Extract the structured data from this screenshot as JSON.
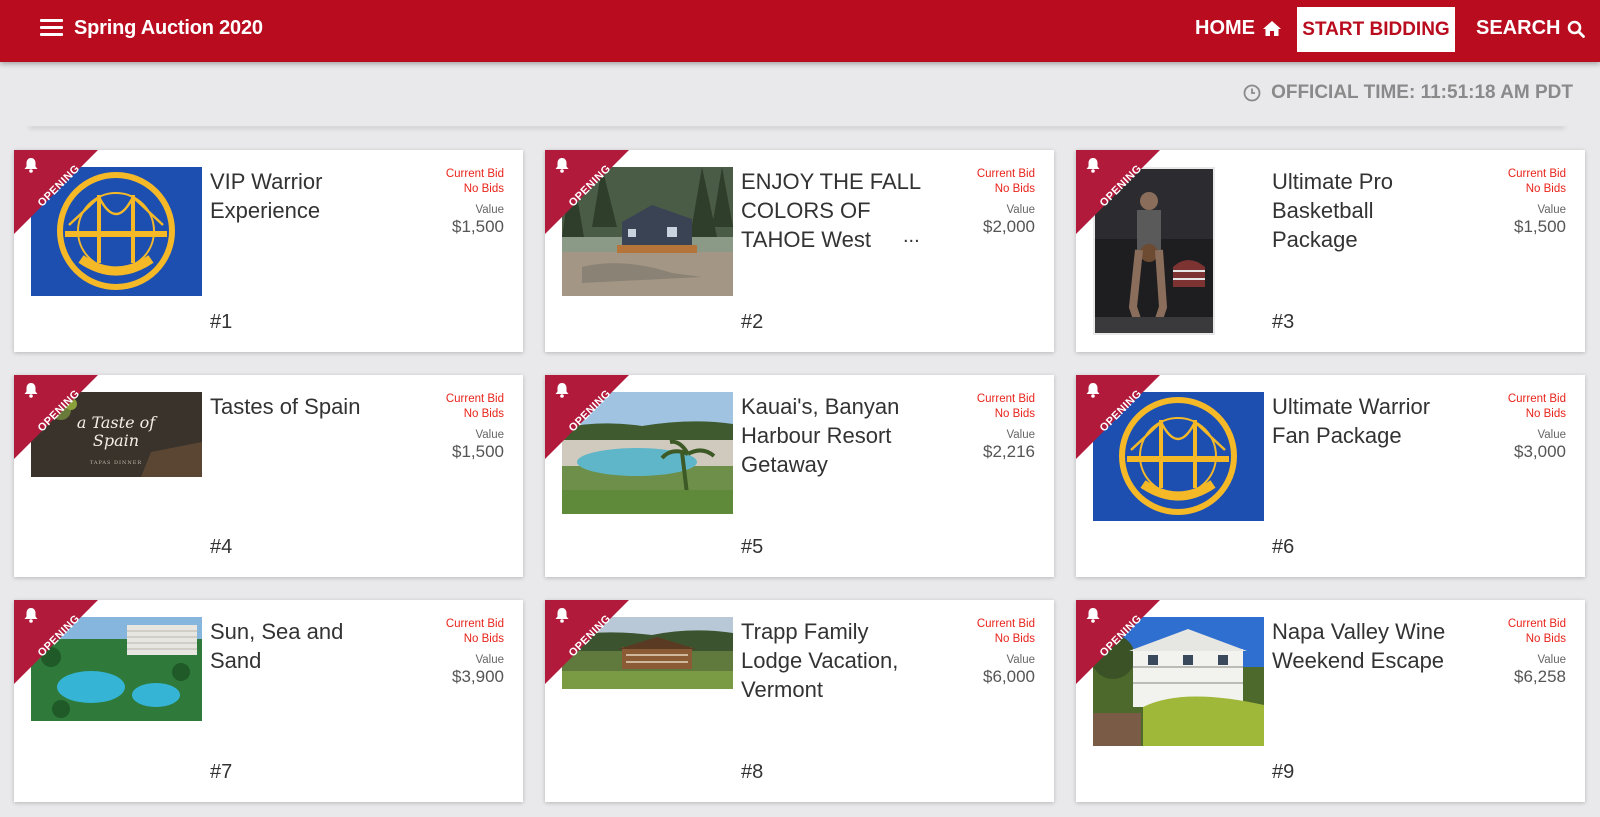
{
  "header": {
    "title": "Spring Auction 2020",
    "home_label": "HOME",
    "bid_label": "START BIDDING",
    "search_label": "SEARCH"
  },
  "official_time": "OFFICIAL TIME: 11:51:18 AM PDT",
  "ribbon_label": "OPENING",
  "labels": {
    "current_bid": "Current Bid",
    "value": "Value"
  },
  "colors": {
    "brand": "#b90c1e",
    "ribbon": "#b21a3c",
    "bid_text": "#e8241b",
    "background": "#e9e8eb"
  },
  "items": [
    {
      "title": "VIP Warrior Experience",
      "current_bid": "No Bids",
      "value": "$1,500",
      "number": "#1",
      "image": "golden-state-warriors-logo"
    },
    {
      "title": "ENJOY THE FALL COLORS OF TAHOE West",
      "ellipsis": "...",
      "current_bid": "No Bids",
      "value": "$2,000",
      "number": "#2",
      "image": "tahoe-cabin-photo"
    },
    {
      "title": "Ultimate Pro Basketball Package",
      "current_bid": "No Bids",
      "value": "$1,500",
      "number": "#3",
      "image": "basketball-player-photo"
    },
    {
      "title": "Tastes of Spain",
      "current_bid": "No Bids",
      "value": "$1,500",
      "number": "#4",
      "image": "tastes-of-spain-photo",
      "image_text": "a Taste of Spain",
      "image_subtext": "TAPAS DINNER"
    },
    {
      "title": "Kauai's, Banyan Harbour Resort Getaway",
      "current_bid": "No Bids",
      "value": "$2,216",
      "number": "#5",
      "image": "resort-pool-photo"
    },
    {
      "title": "Ultimate Warrior Fan Package",
      "current_bid": "No Bids",
      "value": "$3,000",
      "number": "#6",
      "image": "golden-state-warriors-logo"
    },
    {
      "title": "Sun, Sea and Sand",
      "current_bid": "No Bids",
      "value": "$3,900",
      "number": "#7",
      "image": "tropical-resort-photo"
    },
    {
      "title": "Trapp Family Lodge Vacation, Vermont",
      "current_bid": "No Bids",
      "value": "$6,000",
      "number": "#8",
      "image": "mountain-lodge-photo"
    },
    {
      "title": "Napa Valley Wine Weekend Escape",
      "current_bid": "No Bids",
      "value": "$6,258",
      "number": "#9",
      "image": "napa-house-photo"
    }
  ]
}
